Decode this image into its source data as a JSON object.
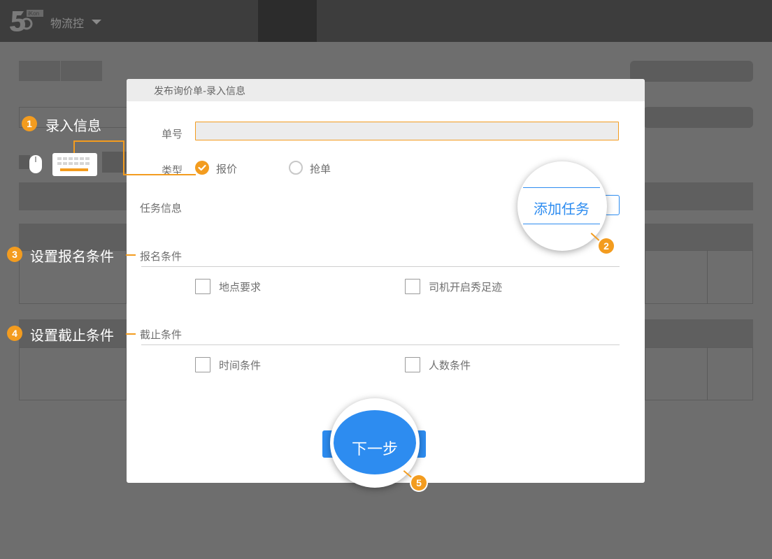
{
  "app": {
    "name": "物流控",
    "logo_icon": "logo-56-icon"
  },
  "modal": {
    "title": "发布询价单-录入信息",
    "fields": {
      "number_label": "单号",
      "number_value": "",
      "type_label": "类型",
      "type_options": [
        {
          "label": "报价",
          "checked": true
        },
        {
          "label": "抢单",
          "checked": false
        }
      ],
      "task_label": "任务信息",
      "add_task_button": "添加任务"
    },
    "signup_section": {
      "title": "报名条件",
      "options": [
        {
          "label": "地点要求",
          "checked": false
        },
        {
          "label": "司机开启秀足迹",
          "checked": false
        }
      ]
    },
    "deadline_section": {
      "title": "截止条件",
      "options": [
        {
          "label": "时间条件",
          "checked": false
        },
        {
          "label": "人数条件",
          "checked": false
        }
      ]
    },
    "next_button": "下一步"
  },
  "annotations": {
    "step1": {
      "num": "1",
      "label": "录入信息"
    },
    "step2": {
      "num": "2"
    },
    "step3": {
      "num": "3",
      "label": "设置报名条件"
    },
    "step4": {
      "num": "4",
      "label": "设置截止条件"
    },
    "step5": {
      "num": "5"
    }
  },
  "colors": {
    "accent": "#f39c1f",
    "primary": "#2d8cf0",
    "overlay": "#6e6e6e"
  }
}
